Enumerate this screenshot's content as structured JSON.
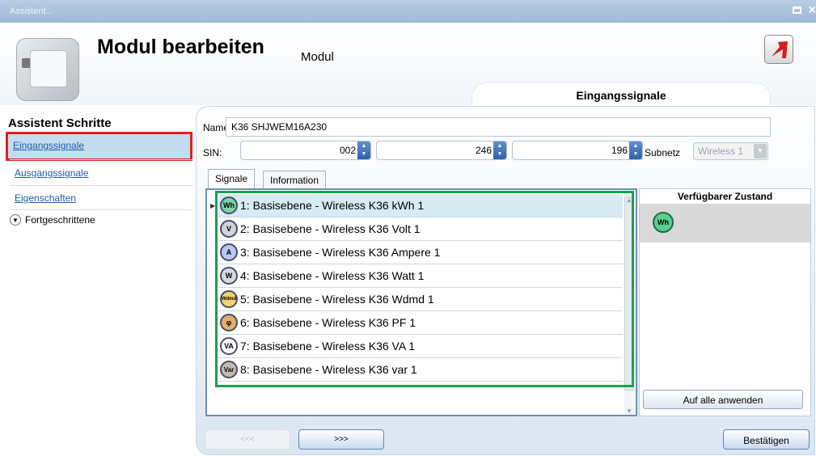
{
  "window": {
    "title": "Assistent..."
  },
  "header": {
    "title": "Modul bearbeiten",
    "subtitle": "Modul",
    "section_tab": "Eingangssignale"
  },
  "sidebar": {
    "title": "Assistent Schritte",
    "items": [
      {
        "label": "Eingangssignale"
      },
      {
        "label": "Ausgangssignale"
      },
      {
        "label": "Eigenschaften"
      }
    ],
    "advanced": "Fortgeschrittene"
  },
  "form": {
    "name_label": "Name",
    "name_value": "K36 SHJWEM16A230",
    "sin_label": "SIN:",
    "sin_values": [
      "002",
      "246",
      "196"
    ],
    "subnet_label": "Subnetz",
    "subnet_value": "Wireless 1"
  },
  "tabs": [
    "Signale",
    "Information"
  ],
  "signals": [
    {
      "text": "1: Basisebene - Wireless K36 kWh 1",
      "icon": "Wh",
      "icon_color": "#7bd4a4"
    },
    {
      "text": "2: Basisebene - Wireless K36 Volt 1",
      "icon": "V",
      "icon_color": "#cfd3db"
    },
    {
      "text": "3: Basisebene - Wireless K36 Ampere 1",
      "icon": "A",
      "icon_color": "#b9c6f0"
    },
    {
      "text": "4: Basisebene - Wireless K36 Watt 1",
      "icon": "W",
      "icon_color": "#d7dae0"
    },
    {
      "text": "5: Basisebene - Wireless K36 Wdmd 1",
      "icon": "Wdmd",
      "icon_color": "#f3d36a"
    },
    {
      "text": "6: Basisebene - Wireless K36 PF 1",
      "icon": "φ",
      "icon_color": "#e3b06a"
    },
    {
      "text": "7: Basisebene - Wireless K36 VA 1",
      "icon": "VA",
      "icon_color": "#ffffff"
    },
    {
      "text": "8: Basisebene - Wireless K36 var 1",
      "icon": "Var",
      "icon_color": "#c7b9b2"
    }
  ],
  "status_panel": {
    "header": "Verfügbarer Zustand",
    "icon": "Wh",
    "apply_label": "Auf alle anwenden"
  },
  "nav": {
    "prev": "<<<",
    "next": ">>>",
    "confirm": "Bestätigen"
  }
}
